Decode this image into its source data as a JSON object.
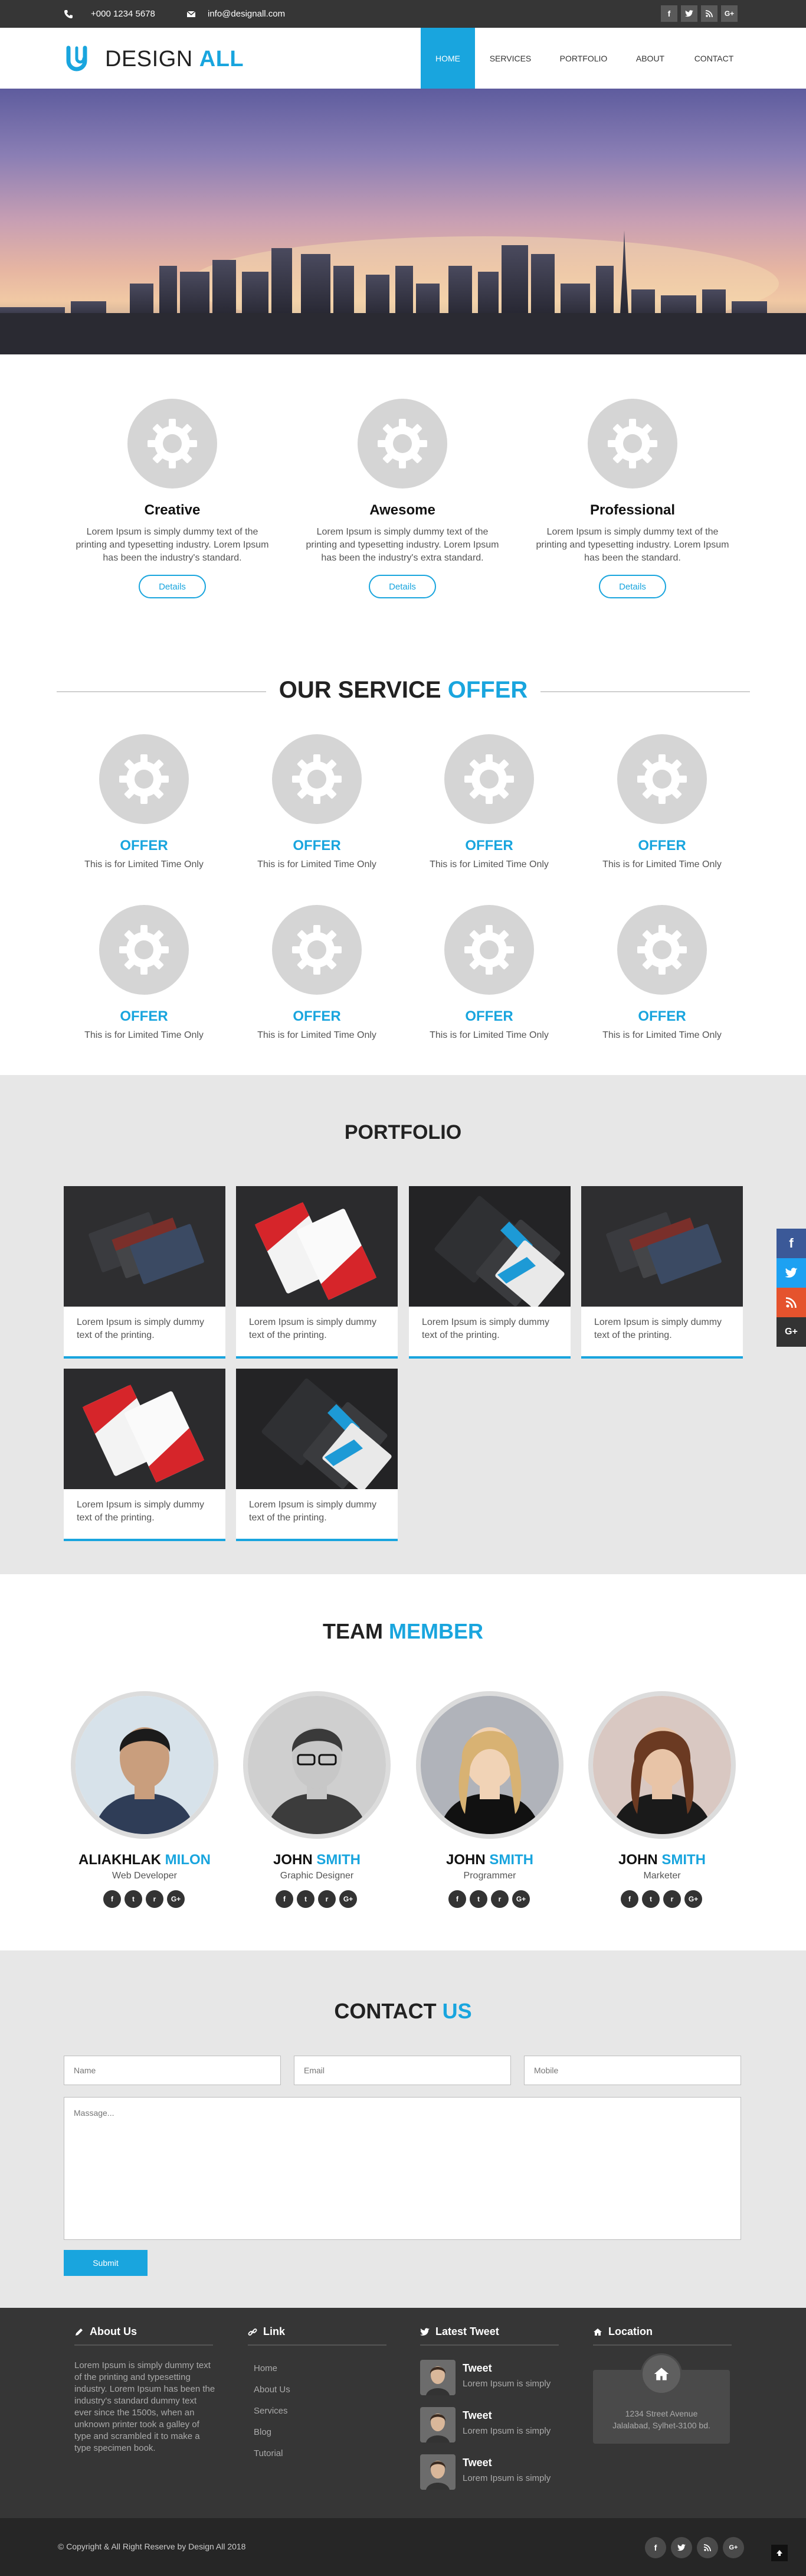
{
  "topbar": {
    "phone": "+000 1234 5678",
    "email": "info@designall.com",
    "social": [
      {
        "icon": "facebook-icon",
        "glyph": "f"
      },
      {
        "icon": "twitter-icon",
        "glyph": "t"
      },
      {
        "icon": "rss-icon",
        "glyph": "r"
      },
      {
        "icon": "google-plus-icon",
        "glyph": "G+"
      }
    ]
  },
  "logo": {
    "text_main": "DESIGN",
    "text_accent": "ALL"
  },
  "nav": [
    {
      "label": "HOME",
      "active": true
    },
    {
      "label": "SERVICES",
      "active": false
    },
    {
      "label": "PORTFOLIO",
      "active": false
    },
    {
      "label": "ABOUT",
      "active": false
    },
    {
      "label": "CONTACT",
      "active": false
    }
  ],
  "features": [
    {
      "title": "Creative",
      "text": "Lorem Ipsum is simply dummy text of the printing and typesetting industry. Lorem Ipsum has been the industry's standard.",
      "button": "Details"
    },
    {
      "title": "Awesome",
      "text": "Lorem Ipsum is simply dummy text of the printing and typesetting industry. Lorem Ipsum has been the industry's extra standard.",
      "button": "Details"
    },
    {
      "title": "Professional",
      "text": "Lorem Ipsum is simply dummy text of the printing and typesetting industry. Lorem Ipsum has been the standard.",
      "button": "Details"
    }
  ],
  "services": {
    "heading_main": "OUR SERVICE",
    "heading_accent": "OFFER",
    "items": [
      {
        "title": "OFFER",
        "text": "This is for Limited Time Only"
      },
      {
        "title": "OFFER",
        "text": "This is for Limited Time Only"
      },
      {
        "title": "OFFER",
        "text": "This is for Limited Time Only"
      },
      {
        "title": "OFFER",
        "text": "This is for Limited Time Only"
      },
      {
        "title": "OFFER",
        "text": "This is for Limited Time Only"
      },
      {
        "title": "OFFER",
        "text": "This is for Limited Time Only"
      },
      {
        "title": "OFFER",
        "text": "This is for Limited Time Only"
      },
      {
        "title": "OFFER",
        "text": "This is for Limited Time Only"
      }
    ]
  },
  "portfolio": {
    "heading": "PORTFOLIO",
    "items": [
      {
        "text": "Lorem Ipsum is simply dummy text of the printing.",
        "style": "dark-red"
      },
      {
        "text": "Lorem Ipsum is simply dummy text of the printing.",
        "style": "white-red"
      },
      {
        "text": "Lorem Ipsum is simply dummy text of the printing.",
        "style": "dark-blue"
      },
      {
        "text": "Lorem Ipsum is simply dummy text of the printing.",
        "style": "dark-red"
      },
      {
        "text": "Lorem Ipsum is simply dummy text of the printing.",
        "style": "white-red"
      },
      {
        "text": "Lorem Ipsum is simply dummy text of the printing.",
        "style": "dark-blue"
      }
    ]
  },
  "team": {
    "heading_main": "TEAM",
    "heading_accent": "MEMBER",
    "members": [
      {
        "first": "ALIAKHLAK",
        "last": "MILON",
        "role": "Web Developer"
      },
      {
        "first": "JOHN",
        "last": "SMITH",
        "role": "Graphic Designer"
      },
      {
        "first": "JOHN",
        "last": "SMITH",
        "role": "Programmer"
      },
      {
        "first": "JOHN",
        "last": "SMITH",
        "role": "Marketer"
      }
    ]
  },
  "contact": {
    "heading_main": "CONTACT",
    "heading_accent": "US",
    "name_placeholder": "Name",
    "email_placeholder": "Email",
    "mobile_placeholder": "Mobile",
    "message_placeholder": "Massage...",
    "submit": "Submit"
  },
  "footer": {
    "about_heading": "About Us",
    "about_text": "Lorem Ipsum is simply dummy text of the printing and typesetting industry. Lorem Ipsum has been the industry's standard dummy text ever since the 1500s, when an unknown printer took a galley of type and scrambled it to make a type specimen book.",
    "link_heading": "Link",
    "links": [
      "Home",
      "About Us",
      "Services",
      "Blog",
      "Tutorial"
    ],
    "tweet_heading": "Latest Tweet",
    "tweets": [
      {
        "title": "Tweet",
        "text": "Lorem Ipsum is simply"
      },
      {
        "title": "Tweet",
        "text": "Lorem Ipsum is simply"
      },
      {
        "title": "Tweet",
        "text": "Lorem Ipsum is simply"
      }
    ],
    "location_heading": "Location",
    "address_line1": "1234 Street Avenue",
    "address_line2": "Jalalabad, Sylhet-3100 bd.",
    "copyright": "© Copyright & All Right Reserve by Design All 2018"
  },
  "side_social": [
    "facebook-icon",
    "twitter-icon",
    "rss-icon",
    "google-plus-icon"
  ],
  "colors": {
    "accent": "#19a5de",
    "dark": "#363636",
    "light_section": "#e7e7e7"
  }
}
